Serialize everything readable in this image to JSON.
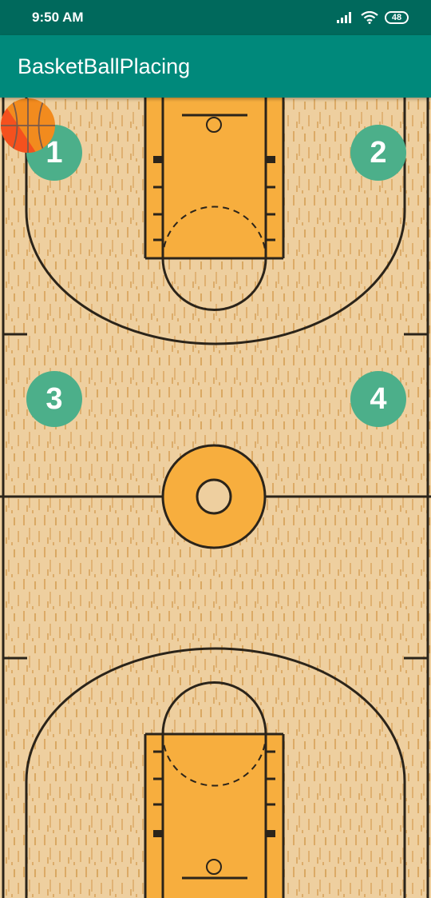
{
  "status_bar": {
    "time": "9:50 AM",
    "battery": "48",
    "icons": [
      "signal-icon",
      "wifi-icon",
      "battery-icon"
    ]
  },
  "app_bar": {
    "title": "BasketBallPlacing",
    "color": "#00897b"
  },
  "court": {
    "floor_color": "#eecf9f",
    "paint_color": "#f7ae3e",
    "line_color": "#2b241a",
    "positions": [
      {
        "label": "1"
      },
      {
        "label": "2"
      },
      {
        "label": "3"
      },
      {
        "label": "4"
      }
    ],
    "position_button_color": "#4caf8a",
    "ball_icon": "basketball-icon"
  }
}
